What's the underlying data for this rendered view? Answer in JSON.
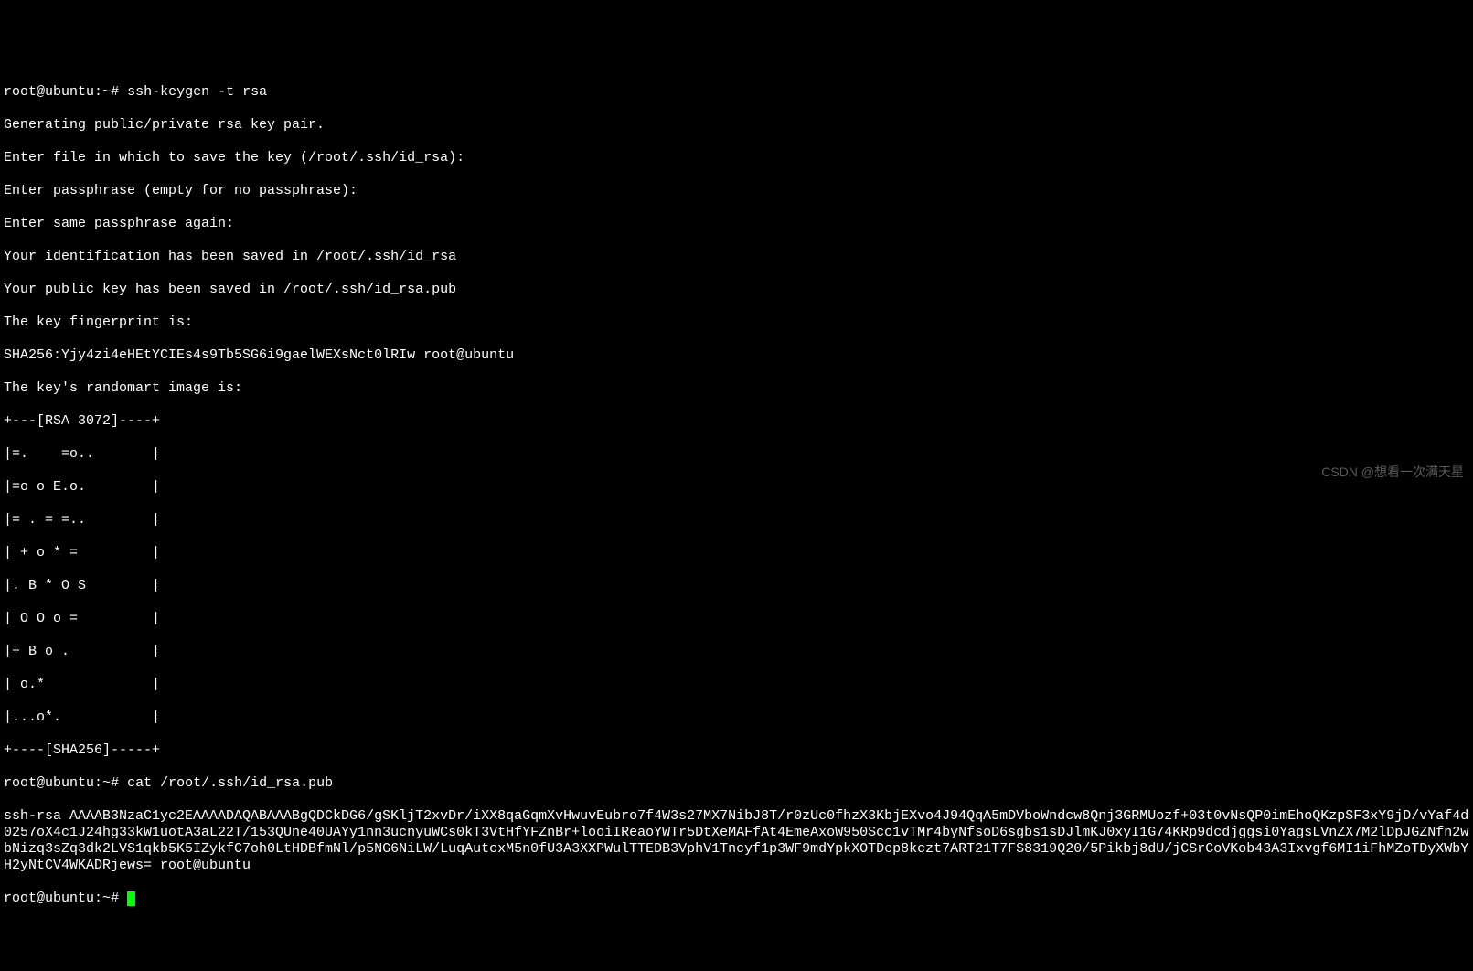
{
  "prompt1": {
    "userhost": "root@ubuntu",
    "sep": ":",
    "path": "~",
    "sigil": "#",
    "command": "ssh-keygen -t rsa"
  },
  "output": {
    "l1": "Generating public/private rsa key pair.",
    "l2": "Enter file in which to save the key (/root/.ssh/id_rsa):",
    "l3": "Enter passphrase (empty for no passphrase):",
    "l4": "Enter same passphrase again:",
    "l5": "Your identification has been saved in /root/.ssh/id_rsa",
    "l6": "Your public key has been saved in /root/.ssh/id_rsa.pub",
    "l7": "The key fingerprint is:",
    "l8": "SHA256:Yjy4zi4eHEtYCIEs4s9Tb5SG6i9gaelWEXsNct0lRIw root@ubuntu",
    "l9": "The key's randomart image is:",
    "r0": "+---[RSA 3072]----+",
    "r1": "|=.    =o..       |",
    "r2": "|=o o E.o.        |",
    "r3": "|= . = =..        |",
    "r4": "| + o * =         |",
    "r5": "|. B * O S        |",
    "r6": "| O O o =         |",
    "r7": "|+ B o .          |",
    "r8": "| o.*             |",
    "r9": "|...o*.           |",
    "r10": "+----[SHA256]-----+"
  },
  "prompt2": {
    "userhost": "root@ubuntu",
    "sep": ":",
    "path": "~",
    "sigil": "#",
    "command": "cat /root/.ssh/id_rsa.pub"
  },
  "pubkey": "ssh-rsa AAAAB3NzaC1yc2EAAAADAQABAAABgQDCkDG6/gSKljT2xvDr/iXX8qaGqmXvHwuvEubro7f4W3s27MX7NibJ8T/r0zUc0fhzX3KbjEXvo4J94QqA5mDVboWndcw8Qnj3GRMUozf+03t0vNsQP0imEhoQKzpSF3xY9jD/vYaf4d0257oX4c1J24hg33kW1uotA3aL22T/153QUne40UAYy1nn3ucnyuWCs0kT3VtHfYFZnBr+looiIReaoYWTr5DtXeMAFfAt4EmeAxoW950Scc1vTMr4byNfsoD6sgbs1sDJlmKJ0xyI1G74KRp9dcdjggsi0YagsLVnZX7M2lDpJGZNfn2wbNizq3sZq3dk2LVS1qkb5K5IZykfC7oh0LtHDBfmNl/p5NG6NiLW/LuqAutcxM5n0fU3A3XXPWulTTEDB3VphV1Tncyf1p3WF9mdYpkXOTDep8kczt7ART21T7FS8319Q20/5Pikbj8dU/jCSrCoVKob43A3Ixvgf6MI1iFhMZoTDyXWbYH2yNtCV4WKADRjews= root@ubuntu",
  "prompt3": {
    "userhost": "root@ubuntu",
    "sep": ":",
    "path": "~",
    "sigil": "#"
  },
  "watermark": "CSDN @想看一次满天星"
}
